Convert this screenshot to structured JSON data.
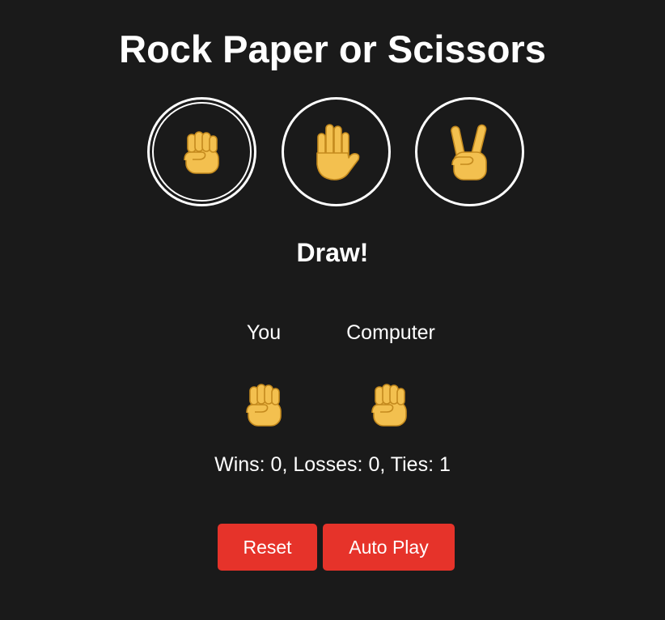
{
  "title": "Rock Paper or Scissors",
  "choices": [
    {
      "label": "Rock",
      "icon": "rock-fist-icon",
      "selected": true
    },
    {
      "label": "Paper",
      "icon": "paper-hand-icon",
      "selected": false
    },
    {
      "label": "Scissors",
      "icon": "scissors-victory-hand-icon",
      "selected": false
    }
  ],
  "result": "Draw!",
  "players": {
    "you_label": "You",
    "computer_label": "Computer",
    "you_move_icon": "rock-fist-icon",
    "computer_move_icon": "rock-fist-icon"
  },
  "score": {
    "text": "Wins: 0, Losses: 0, Ties: 1",
    "wins": 0,
    "losses": 0,
    "ties": 1
  },
  "buttons": {
    "reset": "Reset",
    "auto_play": "Auto Play"
  },
  "colors": {
    "background": "#1a1a1a",
    "text": "#ffffff",
    "button": "#e6332a",
    "emoji_skin": "#f3c04f"
  }
}
